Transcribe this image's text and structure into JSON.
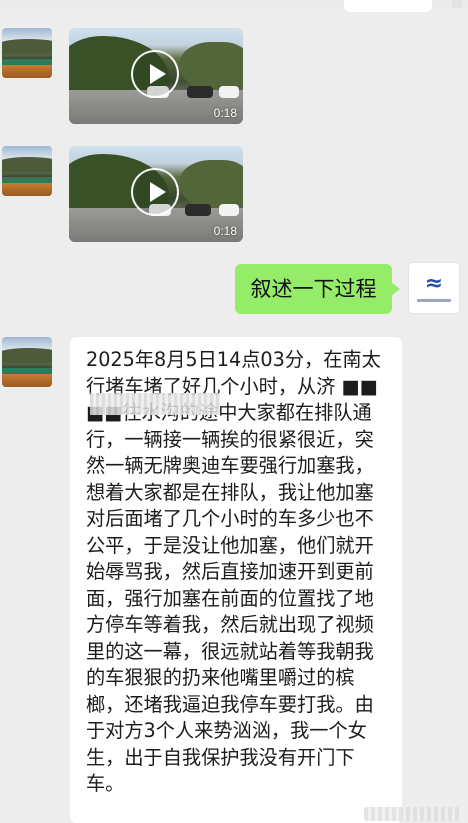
{
  "chat": {
    "videos": [
      {
        "duration": "0:18"
      },
      {
        "duration": "0:18"
      }
    ],
    "my_message": "叙述一下过程",
    "their_message": "2025年8月5日14点03分，在南太行堵车堵了好几个小时，从济   ■■■■往水沟的途中大家都在排队通行，一辆接一辆挨的很紧很近，突然一辆无牌奥迪车要强行加塞我，想着大家都是在排队，我让他加塞对后面堵了几个小时的车多少也不公平，于是没让他加塞，他们就开始辱骂我，然后直接加速开到更前面，强行加塞在前面的位置找了地方停车等着我，然后就出现了视频里的这一幕，很远就站着等我朝我的车狠狠的扔来他嘴里嚼过的槟榔，还堵我逼迫我停车要打我。由于对方3个人来势汹汹，我一个女生，出于自我保护我没有开门下车。"
  },
  "colors": {
    "background": "#ededed",
    "my_bubble": "#95ec69",
    "their_bubble": "#ffffff"
  }
}
